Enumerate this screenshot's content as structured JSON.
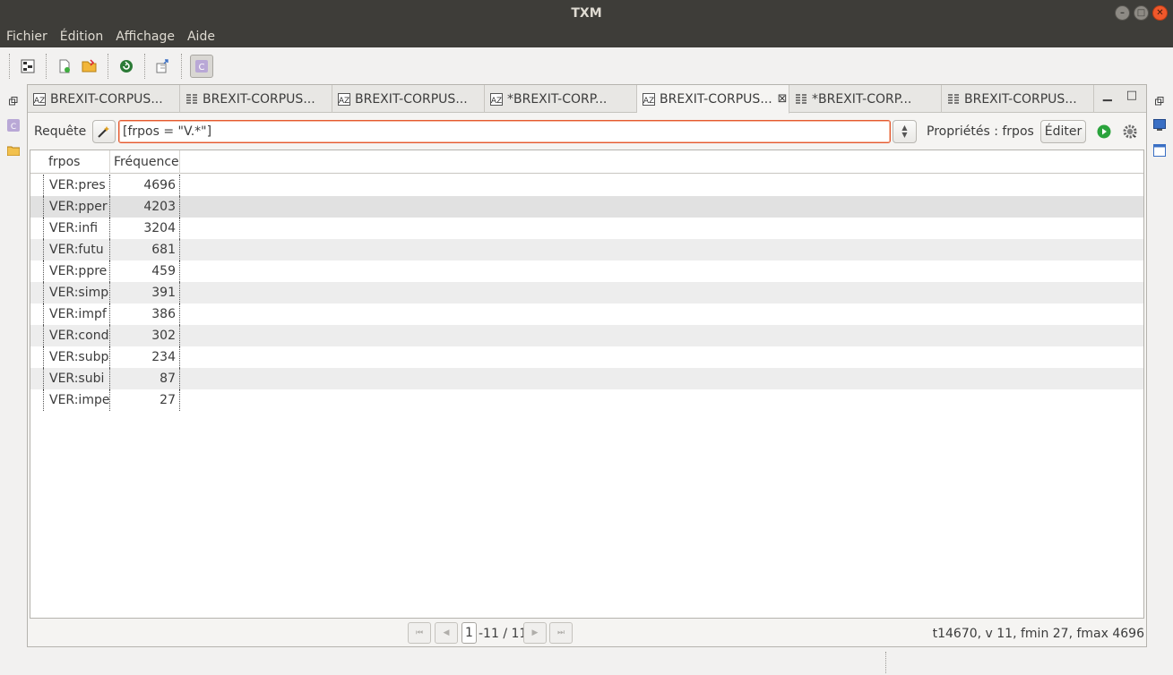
{
  "window": {
    "title": "TXM"
  },
  "menu": [
    "Fichier",
    "Édition",
    "Affichage",
    "Aide"
  ],
  "tabs": [
    {
      "label": "BREXIT-CORPUS...",
      "icon": "lexicon-icon",
      "active": false
    },
    {
      "label": "BREXIT-CORPUS...",
      "icon": "table-icon",
      "active": false
    },
    {
      "label": "BREXIT-CORPUS...",
      "icon": "lexicon-icon",
      "active": false
    },
    {
      "label": "*BREXIT-CORP...",
      "icon": "lexicon-icon",
      "active": false
    },
    {
      "label": "BREXIT-CORPUS...",
      "icon": "lexicon-icon",
      "active": true
    },
    {
      "label": "*BREXIT-CORP...",
      "icon": "table-icon",
      "active": false
    },
    {
      "label": "BREXIT-CORPUS...",
      "icon": "table-icon",
      "active": false
    }
  ],
  "query": {
    "label": "Requête",
    "value": "[frpos = \"V.*\"]",
    "properties_label": "Propriétés : frpos",
    "edit_label": "Éditer"
  },
  "table": {
    "columns": [
      "frpos",
      "Fréquence"
    ],
    "rows": [
      {
        "pos": "VER:pres",
        "freq": "4696"
      },
      {
        "pos": "VER:pper",
        "freq": "4203"
      },
      {
        "pos": "VER:infi",
        "freq": "3204"
      },
      {
        "pos": "VER:futu",
        "freq": "681"
      },
      {
        "pos": "VER:ppre",
        "freq": "459"
      },
      {
        "pos": "VER:simp",
        "freq": "391"
      },
      {
        "pos": "VER:impf",
        "freq": "386"
      },
      {
        "pos": "VER:cond",
        "freq": "302"
      },
      {
        "pos": "VER:subp",
        "freq": "234"
      },
      {
        "pos": "VER:subi",
        "freq": "87"
      },
      {
        "pos": "VER:impe",
        "freq": "27"
      }
    ],
    "selected_row": 1
  },
  "pagination": {
    "current": "1",
    "total": "-11 / 11"
  },
  "stats": "t14670, v 11, fmin 27, fmax 4696",
  "colors": {
    "accent": "#e4582f",
    "titlebar": "#3e3d39",
    "run": "#2aa33c"
  }
}
